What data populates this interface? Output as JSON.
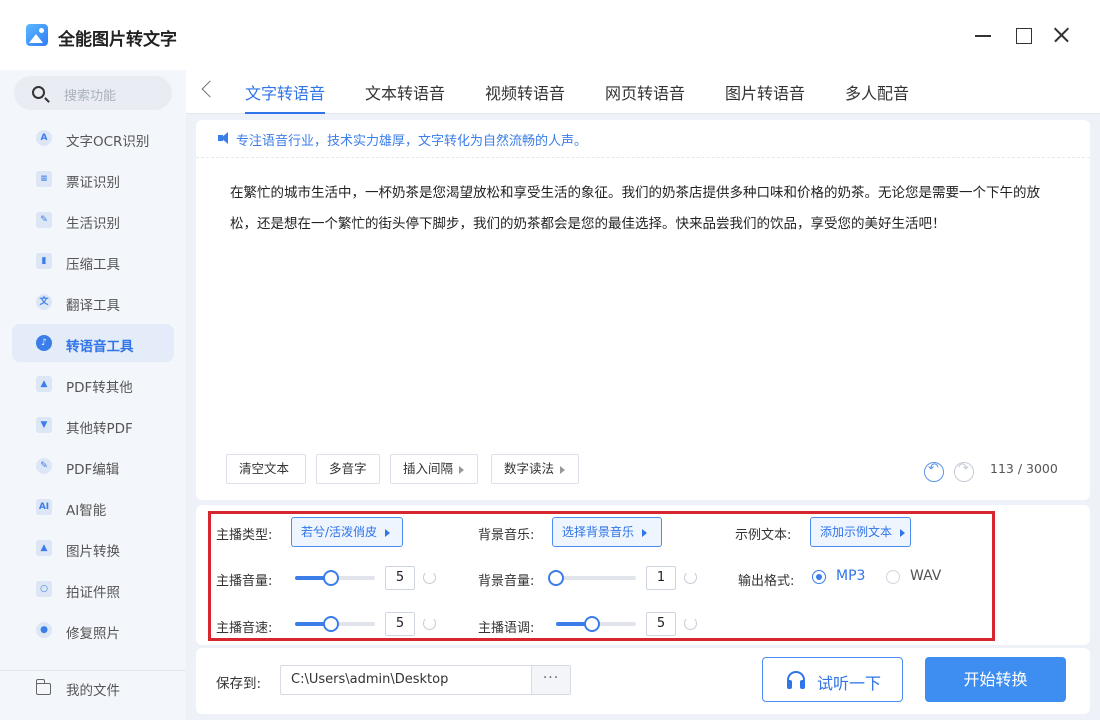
{
  "app": {
    "title": "全能图片转文字"
  },
  "search": {
    "placeholder": "搜索功能"
  },
  "sidebar": {
    "items": [
      {
        "label": "文字OCR识别",
        "icon": "A"
      },
      {
        "label": "票证识别",
        "icon": "≡"
      },
      {
        "label": "生活识别",
        "icon": "✎"
      },
      {
        "label": "压缩工具",
        "icon": "▮"
      },
      {
        "label": "翻译工具",
        "icon": "文"
      },
      {
        "label": "转语音工具",
        "icon": "♪",
        "active": true
      },
      {
        "label": "PDF转其他",
        "icon": "▲"
      },
      {
        "label": "其他转PDF",
        "icon": "▼"
      },
      {
        "label": "PDF编辑",
        "icon": "✎"
      },
      {
        "label": "AI智能",
        "icon": "AI"
      },
      {
        "label": "图片转换",
        "icon": "▲"
      },
      {
        "label": "拍证件照",
        "icon": "○"
      },
      {
        "label": "修复照片",
        "icon": "●"
      }
    ],
    "files_label": "我的文件"
  },
  "tabs": [
    {
      "label": "文字转语音",
      "active": true
    },
    {
      "label": "文本转语音"
    },
    {
      "label": "视频转语音"
    },
    {
      "label": "网页转语音"
    },
    {
      "label": "图片转语音"
    },
    {
      "label": "多人配音"
    }
  ],
  "editor": {
    "hint": "专注语音行业，技术实力雄厚，文字转化为自然流畅的人声。",
    "content": "在繁忙的城市生活中，一杯奶茶是您渴望放松和享受生活的象征。我们的奶茶店提供多种口味和价格的奶茶。无论您是需要一个下午的放松，还是想在一个繁忙的街头停下脚步，我们的奶茶都会是您的最佳选择。快来品尝我们的饮品，享受您的美好生活吧！",
    "buttons": {
      "clear": "清空文本",
      "polyphone": "多音字",
      "insert_pause": "插入间隔",
      "digit_reading": "数字读法"
    },
    "counter": "113 / 3000"
  },
  "settings": {
    "anchor_type_label": "主播类型:",
    "anchor_type_value": "若兮/活泼俏皮",
    "bg_music_label": "背景音乐:",
    "bg_music_value": "选择背景音乐",
    "sample_text_label": "示例文本:",
    "sample_text_value": "添加示例文本",
    "anchor_volume_label": "主播音量:",
    "anchor_volume_value": "5",
    "anchor_volume_level": 0.45,
    "bg_volume_label": "背景音量:",
    "bg_volume_value": "1",
    "bg_volume_level": 0.0,
    "output_format_label": "输出格式:",
    "format_mp3": "MP3",
    "format_wav": "WAV",
    "selected_format": "MP3",
    "anchor_speed_label": "主播音速:",
    "anchor_speed_value": "5",
    "anchor_speed_level": 0.45,
    "anchor_pitch_label": "主播语调:",
    "anchor_pitch_value": "5",
    "anchor_pitch_level": 0.45
  },
  "bottom": {
    "save_label": "保存到:",
    "save_path": "C:\\Users\\admin\\Desktop",
    "browse": "···",
    "preview": "试听一下",
    "convert": "开始转换"
  },
  "colors": {
    "accent": "#2f74e8",
    "highlight_box": "#d8262e",
    "convert_button": "#3d8ef0"
  }
}
